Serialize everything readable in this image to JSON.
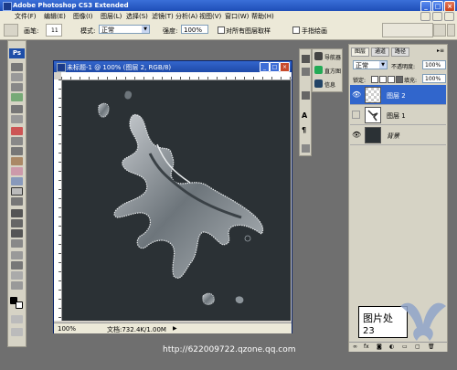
{
  "window": {
    "title": "Adobe Photoshop CS3 Extended",
    "buttons": {
      "minimize": "_",
      "maximize": "□",
      "close": "×"
    }
  },
  "menu": [
    "文件(F)",
    "编辑(E)",
    "图像(I)",
    "图层(L)",
    "选择(S)",
    "滤镜(T)",
    "分析(A)",
    "视图(V)",
    "窗口(W)",
    "帮助(H)"
  ],
  "options": {
    "brush_label": "画笔:",
    "brush_size": "11",
    "mode_label": "模式:",
    "mode_value": "正常",
    "strength_label": "强度:",
    "strength_value": "100%",
    "all_layers_label": "对所有图层取样",
    "finger_label": "手指绘画"
  },
  "tools": {
    "logo": "Ps"
  },
  "document": {
    "title": "未标题-1 @ 100% (图层 2, RGB/8)",
    "zoom": "100%",
    "status": "文档:732.4K/1.00M"
  },
  "nav_panel": {
    "items": [
      {
        "label": "导航器",
        "icon": "navigator-icon"
      },
      {
        "label": "直方图",
        "icon": "histogram-icon"
      },
      {
        "label": "信息",
        "icon": "info-icon"
      }
    ]
  },
  "layers_panel": {
    "tabs": [
      "图层",
      "通道",
      "路径"
    ],
    "blend_mode": "正常",
    "opacity_label": "不透明度:",
    "opacity_value": "100%",
    "lock_label": "锁定:",
    "fill_label": "填充:",
    "fill_value": "100%",
    "layers": [
      {
        "name": "图层 2",
        "selected": true,
        "visible": true
      },
      {
        "name": "图层 1",
        "selected": false,
        "visible": false
      },
      {
        "name": "背景",
        "selected": false,
        "visible": true
      }
    ]
  },
  "watermark": {
    "url": "http://622009722.qzone.qq.com",
    "box_label": "图片处",
    "box_number": "23"
  },
  "colors": {
    "canvas": "#2b3135",
    "accent": "#3a6fd8",
    "selected_layer": "#3166cc"
  }
}
